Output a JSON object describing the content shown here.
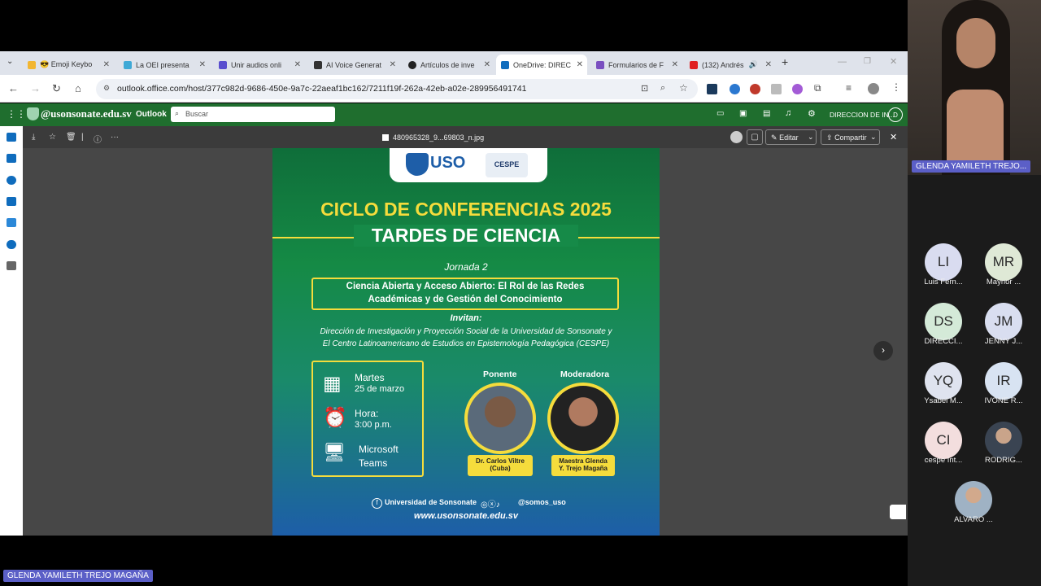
{
  "browser": {
    "tabs": [
      {
        "label": "😎 Emoji Keybo",
        "color": "#f2b632"
      },
      {
        "label": "La OEI presenta",
        "color": "#3fa9d6"
      },
      {
        "label": "Unir audios onli",
        "color": "#5a4fcf"
      },
      {
        "label": "AI Voice Generat",
        "color": "#333333"
      },
      {
        "label": "Artículos de inve",
        "color": "#222222"
      },
      {
        "label": "OneDrive: DIREC",
        "color": "#0f6cbd"
      },
      {
        "label": "Formularios de F",
        "color": "#7a4fc0"
      },
      {
        "label": "(132) Andrés",
        "color": "#e02020"
      }
    ],
    "new_tab": "+",
    "url": "outlook.office.com/host/377c982d-9686-450e-9a7c-22aeaf1bc162/7211f19f-262a-42eb-a02e-289956491741"
  },
  "outlook": {
    "org": "@usonsonate.edu.sv",
    "app": "Outlook",
    "search_placeholder": "Buscar",
    "account": "DIRECCION DE IN...",
    "account_initial": "D"
  },
  "viewer": {
    "filename": "480965328_9...69803_n.jpg",
    "edit": "Editar",
    "share": "Compartir"
  },
  "poster": {
    "logo_text": "USO",
    "logo2_text": "CESPE",
    "title1": "CICLO DE CONFERENCIAS 2025",
    "title2": "TARDES DE CIENCIA",
    "jornada": "Jornada 2",
    "topic1": "Ciencia Abierta y Acceso Abierto: El Rol de las Redes",
    "topic2": "Académicas y de Gestión del Conocimiento",
    "invitan": "Invitan:",
    "org1": "Dirección de Investigación y Proyección Social de la Universidad de Sonsonate y",
    "org2": "El Centro Latinoamericano de Estudios en Epistemología Pedagógica (CESPE)",
    "day": "Martes",
    "date": "25 de marzo",
    "hora_label": "Hora:",
    "hora": "3:00 p.m.",
    "platform1": "Microsoft",
    "platform2": "Teams",
    "ponente_label": "Ponente",
    "moderadora_label": "Moderadora",
    "ponente1": "Dr. Carlos Viltre",
    "ponente2": "(Cuba)",
    "moderadora1": "Maestra Glenda",
    "moderadora2": "Y. Trejo Magaña",
    "social1": "Universidad de Sonsonate",
    "social2": "@somos_uso",
    "website": "www.usonsonate.edu.sv"
  },
  "meeting": {
    "speaker_name": "GLENDA YAMILETH TREJO...",
    "bottom_name": "GLENDA YAMILETH TREJO MAGAÑA",
    "participants": [
      {
        "initials": "LI",
        "name": "Luis Fern...",
        "color": "#d9dcf0"
      },
      {
        "initials": "MR",
        "name": "Maynor ...",
        "color": "#dfe9d6"
      },
      {
        "initials": "DS",
        "name": "DIRECCI...",
        "color": "#d4ead8"
      },
      {
        "initials": "JM",
        "name": "JENNY J...",
        "color": "#d9def0"
      },
      {
        "initials": "YQ",
        "name": "Ysabel M...",
        "color": "#dfe3ef"
      },
      {
        "initials": "IR",
        "name": "IVONE R...",
        "color": "#d8e3f2"
      },
      {
        "initials": "CI",
        "name": "cespe Int...",
        "color": "#f3dede"
      },
      {
        "initials": "",
        "name": "RODRIG...",
        "color": "#556070"
      },
      {
        "initials": "",
        "name": "ALVARO ...",
        "color": "#8aa0b5"
      }
    ]
  }
}
